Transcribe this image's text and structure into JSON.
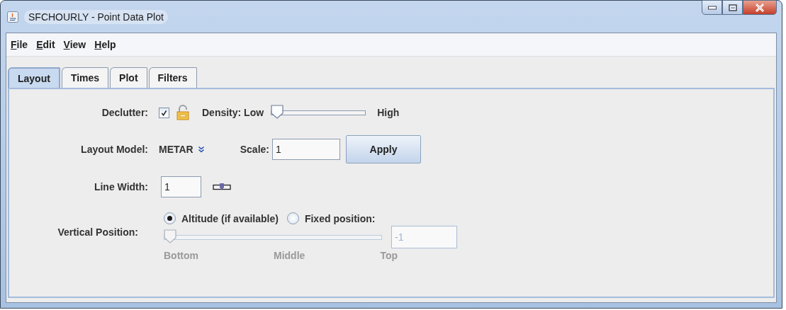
{
  "window": {
    "title": "SFCHOURLY - Point Data Plot"
  },
  "menu": [
    {
      "label": "File"
    },
    {
      "label": "Edit"
    },
    {
      "label": "View"
    },
    {
      "label": "Help"
    }
  ],
  "tabs": [
    {
      "label": "Layout",
      "selected": true
    },
    {
      "label": "Times",
      "selected": false
    },
    {
      "label": "Plot",
      "selected": false
    },
    {
      "label": "Filters",
      "selected": false
    }
  ],
  "declutter": {
    "label": "Declutter:",
    "checked": true,
    "density_label": "Density: Low",
    "density": {
      "level": 0
    },
    "high_label": "High"
  },
  "layout_model": {
    "label": "Layout Model:",
    "value": "METAR",
    "scale_label": "Scale:",
    "scale": "1",
    "apply": "Apply"
  },
  "line_width": {
    "label": "Line Width:",
    "value": "1"
  },
  "vertical_position": {
    "label": "Vertical Position:",
    "options": [
      {
        "label": "Altitude (if available)",
        "selected": true
      },
      {
        "label": "Fixed position:",
        "selected": false
      }
    ],
    "slider": {
      "level": 0,
      "disabled": true
    },
    "value": "-1",
    "value_disabled": true,
    "ticks": [
      "Bottom",
      "Middle",
      "Top"
    ]
  }
}
